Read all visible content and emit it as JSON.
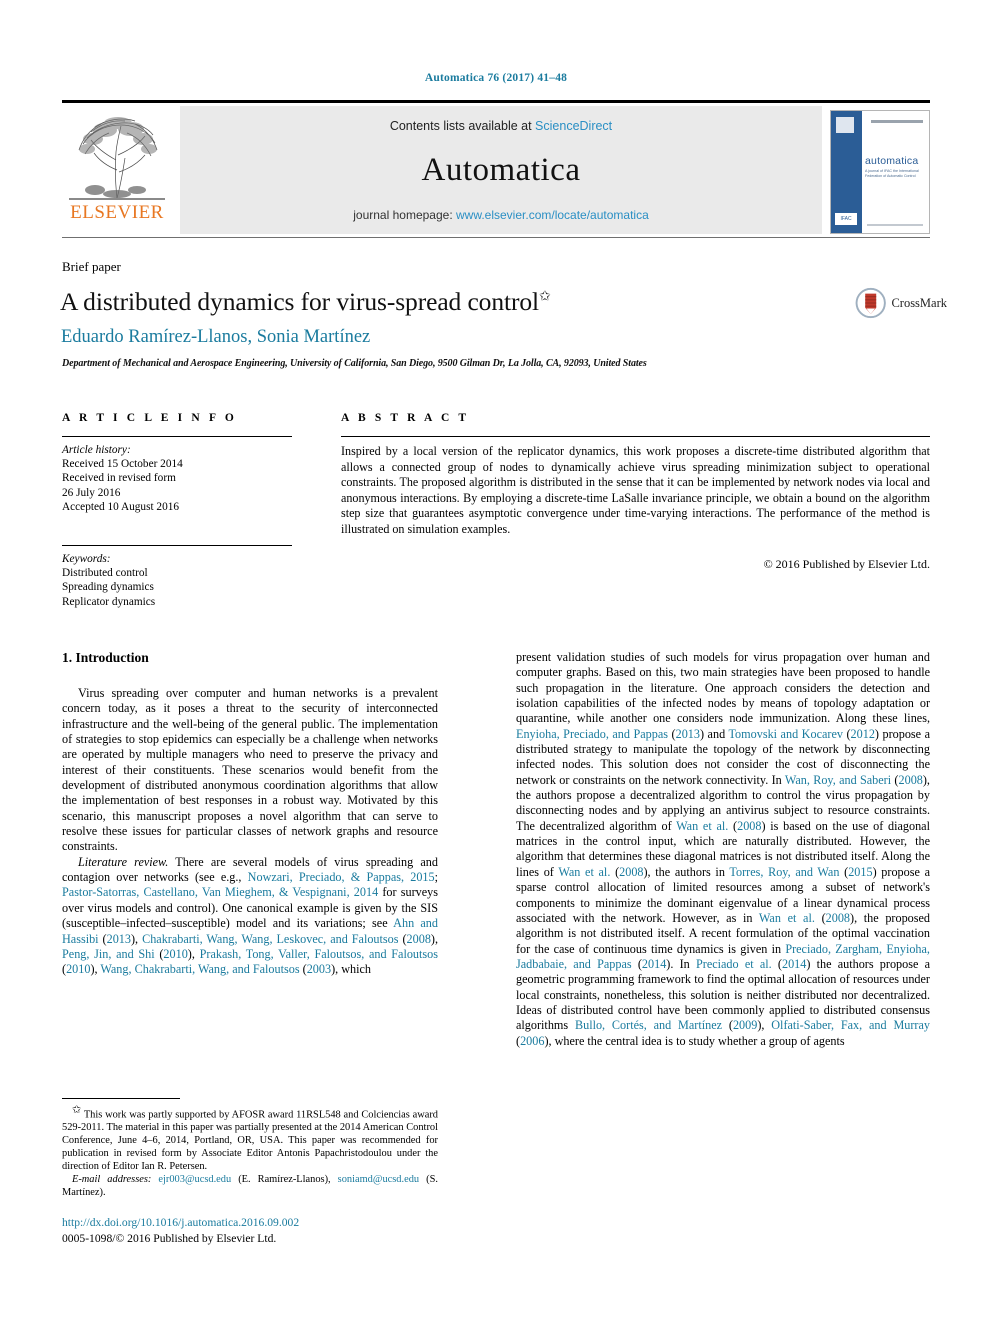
{
  "running_head": "Automatica 76 (2017) 41–48",
  "masthead": {
    "publisher_logo_text": "ELSEVIER",
    "contents_prefix": "Contents lists available at ",
    "contents_link": "ScienceDirect",
    "journal_name": "Automatica",
    "homepage_prefix": "journal homepage: ",
    "homepage_url": "www.elsevier.com/locate/automatica",
    "cover": {
      "title": "automatica",
      "subtitle": "A journal of IFAC the International Federation of Automatic Control",
      "ifac_label": "IFAC"
    }
  },
  "article": {
    "type_label": "Brief paper",
    "title": "A distributed dynamics for virus-spread control",
    "title_footnote_marker": "✩",
    "authors": "Eduardo Ramírez-Llanos, Sonia Martínez",
    "affiliation": "Department of Mechanical and Aerospace Engineering, University of California, San Diego, 9500 Gilman Dr, La Jolla, CA, 92093, United States",
    "crossmark_label": "CrossMark"
  },
  "info": {
    "heading": "A R T I C L E   I N F O",
    "history_label": "Article history:",
    "history_lines": [
      "Received 15 October 2014",
      "Received in revised form",
      "26 July 2016",
      "Accepted 10 August 2016"
    ],
    "keywords_label": "Keywords:",
    "keywords": [
      "Distributed control",
      "Spreading dynamics",
      "Replicator dynamics"
    ]
  },
  "abstract": {
    "heading": "A B S T R A C T",
    "text": "Inspired by a local version of the replicator dynamics, this work proposes a discrete-time distributed algorithm that allows a connected group of nodes to dynamically achieve virus spreading minimization subject to operational constraints. The proposed algorithm is distributed in the sense that it can be implemented by network nodes via local and anonymous interactions. By employing a discrete-time LaSalle invariance principle, we obtain a bound on the algorithm step size that guarantees asymptotic convergence under time-varying interactions. The performance of the method is illustrated on simulation examples.",
    "copyright": "© 2016 Published by Elsevier Ltd."
  },
  "body": {
    "section_title": "1. Introduction",
    "left_paragraph_1": "Virus spreading over computer and human networks is a prevalent concern today, as it poses a threat to the security of interconnected infrastructure and the well-being of the general public. The implementation of strategies to stop epidemics can especially be a challenge when networks are operated by multiple managers who need to preserve the privacy and interest of their constituents. These scenarios would benefit from the development of distributed anonymous coordination algorithms that allow the implementation of best responses in a robust way. Motivated by this scenario, this manuscript proposes a novel algorithm that can serve to resolve these issues for particular classes of network graphs and resource constraints.",
    "lit_review_label": "Literature review.",
    "left_paragraph_2_parts": {
      "t1": " There are several models of virus spreading and contagion over networks (see e.g., ",
      "c1": "Nowzari, Preciado, & Pappas, 2015",
      "t2": "; ",
      "c2": "Pastor-Satorras, Castellano, Van Mieghem, & Vespignani, 2014",
      "t3": " for surveys over virus models and control). One canonical example is given by the SIS (susceptible–infected–susceptible) model and its variations; see ",
      "c3": "Ahn and Hassibi",
      "t4": " (",
      "c4": "2013",
      "t5": "), ",
      "c5": "Chakrabarti, Wang, Wang, Leskovec, and Faloutsos",
      "t6": " (",
      "c6": "2008",
      "t7": "), ",
      "c7": "Peng, Jin, and Shi",
      "t8": " (",
      "c8": "2010",
      "t9": "), ",
      "c9": "Prakash, Tong, Valler, Faloutsos, and Faloutsos",
      "t10": " (",
      "c10": "2010",
      "t11": "), ",
      "c11": "Wang, Chakrabarti, Wang, and Faloutsos",
      "t12": " (",
      "c12": "2003",
      "t13": "), which"
    },
    "right_paragraph_parts": {
      "t1": "present validation studies of such models for virus propagation over human and computer graphs. Based on this, two main strategies have been proposed to handle such propagation in the literature. One approach considers the detection and isolation capabilities of the infected nodes by means of topology adaptation or quarantine, while another one considers node immunization. Along these lines, ",
      "c1": "Enyioha, Preciado, and Pappas",
      "t2": " (",
      "c2": "2013",
      "t3": ") and ",
      "c3": "Tomovski and Kocarev",
      "t4": " (",
      "c4": "2012",
      "t5": ") propose a distributed strategy to manipulate the topology of the network by disconnecting infected nodes. This solution does not consider the cost of disconnecting the network or constraints on the network connectivity. In ",
      "c5": "Wan, Roy, and Saberi",
      "t6": " (",
      "c6": "2008",
      "t7": "), the authors propose a decentralized algorithm to control the virus propagation by disconnecting nodes and by applying an antivirus subject to resource constraints. The decentralized algorithm of ",
      "c7": "Wan et al.",
      "t8": " (",
      "c8": "2008",
      "t9": ") is based on the use of diagonal matrices in the control input, which are naturally distributed. However, the algorithm that determines these diagonal matrices is not distributed itself. Along the lines of ",
      "c9": "Wan et al.",
      "t10": " (",
      "c10": "2008",
      "t11": "), the authors in ",
      "c11": "Torres, Roy, and Wan",
      "t12": " (",
      "c12": "2015",
      "t13": ") propose a sparse control allocation of limited resources among a subset of network's components to minimize the dominant eigenvalue of a linear dynamical process associated with the network. However, as in ",
      "c13": "Wan et al.",
      "t14": " (",
      "c14": "2008",
      "t15": "), the proposed algorithm is not distributed itself. A recent formulation of the optimal vaccination for the case of continuous time dynamics is given in ",
      "c15": "Preciado, Zargham, Enyioha, Jadbabaie, and Pappas",
      "t16": " (",
      "c16": "2014",
      "t17": "). In ",
      "c17": "Preciado et al.",
      "t18": " (",
      "c18": "2014",
      "t19": ") the authors propose a geometric programming framework to find the optimal allocation of resources under local constraints, nonetheless, this solution is neither distributed nor decentralized. Ideas of distributed control have been commonly applied to distributed consensus algorithms ",
      "c19": "Bullo, Cortés, and Martínez",
      "t20": " (",
      "c20": "2009",
      "t21": "), ",
      "c21": "Olfati-Saber, Fax, and Murray",
      "t22": " (",
      "c22": "2006",
      "t23": "), where the central idea is to study whether a group of agents"
    }
  },
  "footnote": {
    "marker": "✩",
    "text": " This work was partly supported by AFOSR award 11RSL548 and Colciencias award 529-2011. The material in this paper was partially presented at the 2014 American Control Conference, June 4–6, 2014, Portland, OR, USA. This paper was recommended for publication in revised form by Associate Editor Antonis Papachristodoulou under the direction of Editor Ian R. Petersen.",
    "email_label": "E-mail addresses:",
    "email_1": "ejr003@ucsd.edu",
    "email_1_owner": " (E. Ramírez-Llanos), ",
    "email_2": "soniamd@ucsd.edu",
    "email_2_owner": "(S. Martínez).",
    "doi": "http://dx.doi.org/10.1016/j.automatica.2016.09.002",
    "issn_line": "0005-1098/© 2016 Published by Elsevier Ltd."
  },
  "colors": {
    "link_blue": "#1a7b9e",
    "sciencedirect_blue": "#2a8fc4",
    "elsevier_orange": "#e87722",
    "cover_blue": "#2b5d96",
    "masthead_grey": "#eaeaea"
  }
}
